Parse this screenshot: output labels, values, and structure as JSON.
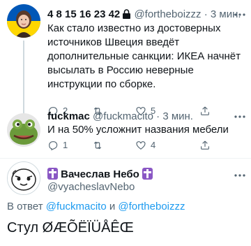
{
  "tweet1": {
    "name": "4 8 15 16 23 42",
    "handle": "@fortheboizzz",
    "dot": "·",
    "time": "3 мин.",
    "text": "Как стало известно из достоверных источников Швеция введёт дополнительные санкции: ИКЕА начнёт высылать в Россию неверные инструкции по сборке.",
    "reply_count": "2",
    "retweet_count": "",
    "like_count": "5"
  },
  "tweet2": {
    "name": "fuckmac",
    "handle": "@fuckmacito",
    "dot": "·",
    "time": "3 мин.",
    "text": "И на 50% усложнит названия мебели",
    "reply_count": "1",
    "retweet_count": "",
    "like_count": "4"
  },
  "main_tweet": {
    "name": "Вачеслав Небо",
    "handle": "@vyacheslavNebo",
    "reply_prefix": "В ответ",
    "reply_user1": "@fuckmacito",
    "reply_and": "и",
    "reply_user2": "@fortheboizzz",
    "text": "Стул ØÆÕËÏÜÅÊŒ"
  },
  "colors": {
    "accent": "#1d9bf0",
    "secondary_text": "#536471",
    "primary_text": "#0f1419"
  },
  "icons": {
    "reply": "reply-icon",
    "retweet": "retweet-icon",
    "like": "heart-icon",
    "share": "share-icon",
    "lock": "lock-icon",
    "more": "more-icon",
    "cross": "orthodox-cross-icon"
  }
}
